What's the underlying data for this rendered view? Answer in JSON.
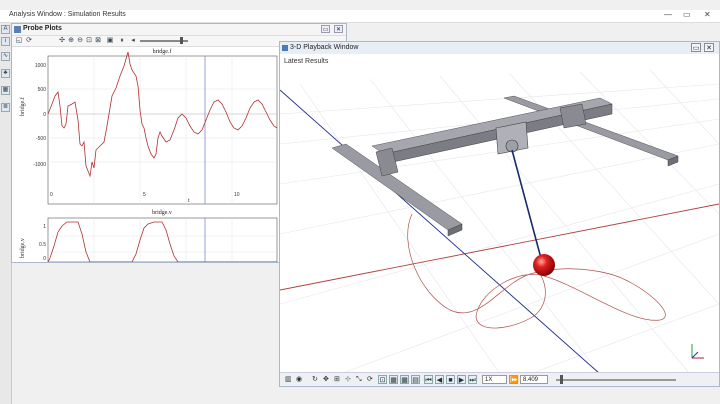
{
  "main_window": {
    "title": "Analysis Window : Simulation Results",
    "controls": [
      "—",
      "▭",
      "✕"
    ]
  },
  "left_strip": {
    "buttons": [
      "A",
      "i",
      "∿",
      "♣",
      "▦",
      "≣"
    ]
  },
  "probe_plots": {
    "title": "Probe Plots",
    "controls": [
      "▭",
      "✕"
    ],
    "toolbar_icons": [
      "◱",
      "⟳",
      "✣",
      "⊕",
      "⊖",
      "⊡",
      "⊠",
      "▣",
      "⏸",
      "◂"
    ],
    "top_plot": {
      "title": "bridge.f",
      "ylabel": "bridge.f",
      "xlabel": "t",
      "yticks": [
        "1000",
        "500",
        "0",
        "-500",
        "-1000"
      ],
      "xticks": [
        "0",
        "5",
        "10"
      ]
    },
    "bottom_plot": {
      "title": "bridge.v",
      "ylabel": "bridge.v",
      "yticks": [
        "1",
        "0.5",
        "0"
      ]
    }
  },
  "playback": {
    "title": "3-D Playback Window",
    "controls": [
      "▭",
      "✕"
    ],
    "label": "Latest Results",
    "speed": "1X",
    "time": "8.409",
    "bottom_icons": [
      "▥",
      "◉",
      "↻",
      "✥",
      "⊞",
      "⊹",
      "⤡",
      "⟳",
      "⊡",
      "▦",
      "▦",
      "▤",
      "⏮",
      "◀",
      "■",
      "▶",
      "⏭",
      "⏩"
    ],
    "colors": {
      "x_axis": "#b04040",
      "z_axis": "#20308a",
      "cable": "#1a2a6a",
      "ball": "#cc1010",
      "trace": "#b05050",
      "beam": "#8e8f96"
    }
  }
}
